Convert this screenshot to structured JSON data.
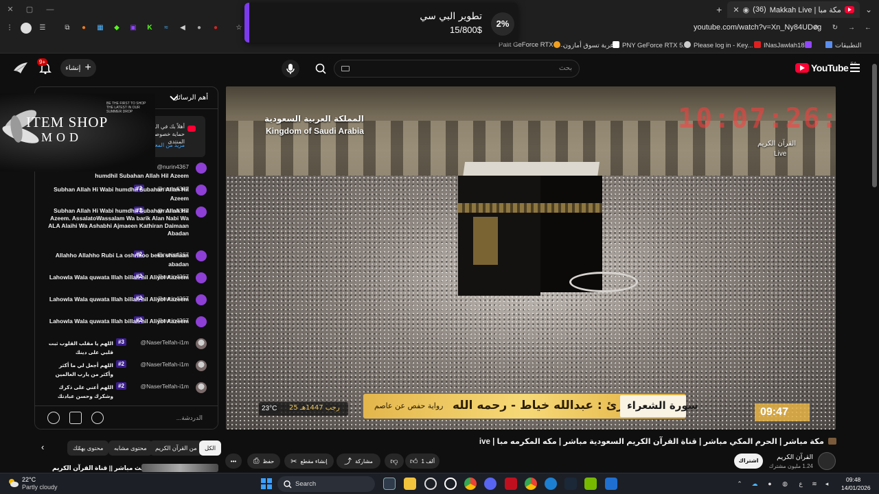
{
  "browser": {
    "tab_title": "Makkah Live | مكة مبا",
    "tab_count": "(36)",
    "url": "youtube.com/watch?v=Xn_Ny84UDeg",
    "bookmarks": [
      {
        "label": "Palit GeForce RTX 5...",
        "color": "#3b3b3b"
      },
      {
        "label": "عربة تسوق أمازون",
        "color": "#f0a020"
      },
      {
        "label": "PNY GeForce RTX 5...",
        "color": "#ffffff"
      },
      {
        "label": "Please log in - Key...",
        "color": "#cccccc"
      },
      {
        "label": "INasJawlah18",
        "color": "#9146ff"
      },
      {
        "label": "التطبيقات",
        "color": "#5a8dee"
      }
    ]
  },
  "popup": {
    "percent": "2%",
    "title": "تطوير البي سي",
    "count": "15/800$"
  },
  "header": {
    "logo_text": "YouTube",
    "region": "SA",
    "search_placeholder": "بحث",
    "create_label": "إنشاء",
    "notif_count": "9+"
  },
  "chat": {
    "title": "أهم الرسائل",
    "pinned_text": "أهلاً بك في الدردشة المباشرة! يُرجى حماية خصوصيتك والالتزام بإرشادات المنتدى",
    "pinned_more": "مزيد من المعلومات",
    "input_placeholder": "الدردشة...",
    "messages": [
      {
        "user": "@nurin4367",
        "badge": "",
        "text": "humdhil Subahan Allah Hil Azeem",
        "avatar": "purple"
      },
      {
        "user": "@nurin4367",
        "badge": "#3",
        "text": "Subhan Allah Hi Wabi humdhil Subahan Allah Hil Azeem",
        "avatar": "purple"
      },
      {
        "user": "@nurin4367",
        "badge": "#2",
        "text": "Subhan Allah Hi Wabi humdhil Subahan Allah Hil Azeem. AssalatoWassalam Wa barik Alan Nabi Wa ALA Alaihi Wa Ashabhi Ajmaeen Kathiran Daimaan Abadan",
        "avatar": "purple"
      },
      {
        "user": "@nurin4367",
        "badge": "#2",
        "text": "Allahho Allahho Rubi La oshrikoo beka shailaan abadan",
        "avatar": "purple"
      },
      {
        "user": "@nurin4367",
        "badge": "#2",
        "text": "Lahowla Wala quwata Illah billah hil Aliyol Aazeem",
        "avatar": "purple"
      },
      {
        "user": "@nurin4367",
        "badge": "#2",
        "text": "Lahowla Wala quwata Illah billah hil Aliyol Aazeem",
        "avatar": "purple"
      },
      {
        "user": "@nurin4367",
        "badge": "#2",
        "text": "Lahowla Wala quwata Illah billah hil Aliyol Aazeem",
        "avatar": "purple"
      },
      {
        "user": "@NaserTelfah-i1m",
        "badge": "#3",
        "text": "اللهم يا مقلب القلوب ثبت قلبي على دينك",
        "avatar": "photo"
      },
      {
        "user": "@NaserTelfah-i1m",
        "badge": "#2",
        "text": "اللهم أجعل لي ما أكثر وأكثر من يارب العالمين",
        "avatar": "photo"
      },
      {
        "user": "@NaserTelfah-i1m",
        "badge": "#2",
        "text": "اللهم أعني على ذكرك وشكرك وحسن عبادتك",
        "avatar": "photo"
      }
    ]
  },
  "overlay": {
    "title": "ITEM SHOP",
    "subtitle": "MOD",
    "small_text": "BE THE FIRST TO SHOP THE LATEST IN OUR SUMMER DROP"
  },
  "video": {
    "watermark_ar": "المملكة العربية السعودية",
    "watermark_en": "Kingdom of Saudi Arabia",
    "clock": "10:07:26:57",
    "channel_overlay": "القرآن الكريم",
    "live_label": "Live",
    "surah": "سورة الشعراء",
    "reciter": "القارئ : عبدالله خياط - رحمه الله",
    "riwaya": "رواية حفص عن عاصم",
    "temp": "23°C",
    "hijri_date": "25 رجب 1447هـ",
    "time": "09:47"
  },
  "below": {
    "title": "مكة مباشر | الحرم المكي مباشر | قناة القرآن الكريم السعودية مباشر | مكه المكرمه مبا | Makkah Live",
    "channel_name": "القرآن الكريم",
    "subscribers": "1.24 مليون مشترك",
    "subscribe_label": "اشتراك",
    "like_count": "1 ألف",
    "share_label": "مشاركة",
    "clip_label": "إنشاء مقطع",
    "save_label": "حفظ",
    "chips": [
      "الكل",
      "من القرآن الكريم",
      "محتوى مشابه",
      "محتوى يهمّك"
    ],
    "rec_title": "بث مباشر || قناة القرآن الكريم Makkah"
  },
  "taskbar": {
    "temp": "22°C",
    "weather": "Partly cloudy",
    "search_label": "Search",
    "time": "09:48",
    "date": "14/01/2026",
    "lang": "ع"
  }
}
